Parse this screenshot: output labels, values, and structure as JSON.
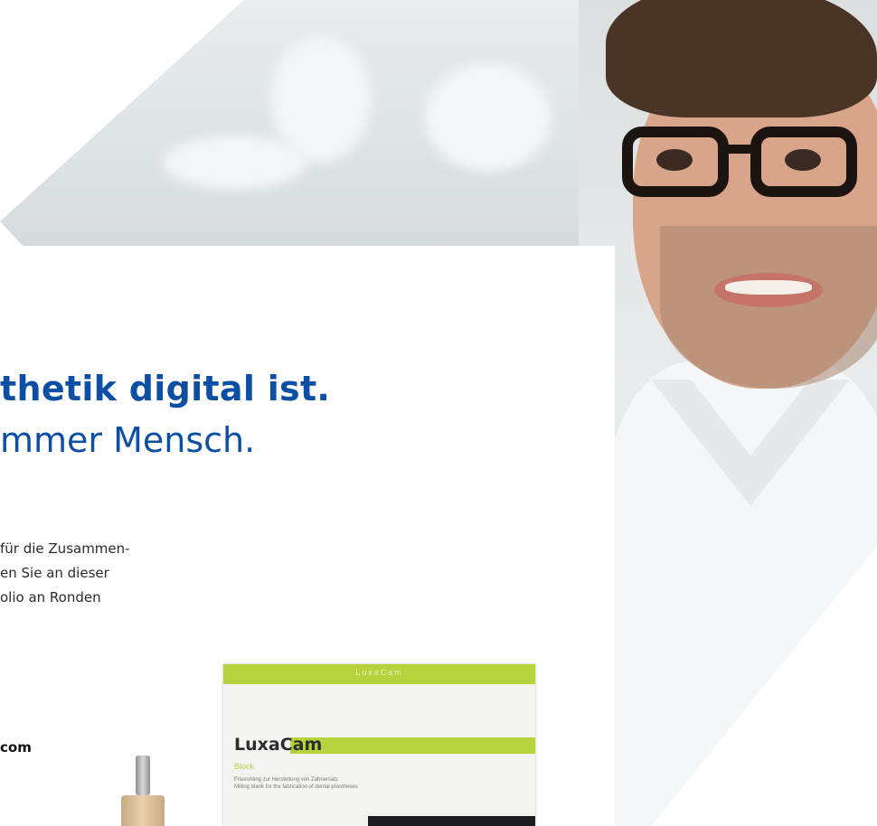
{
  "headline": {
    "line1": "thetik digital ist.",
    "line2": "mmer Mensch."
  },
  "body_lines": [
    "für die Zusammen-",
    "en Sie an dieser",
    "olio an Ronden"
  ],
  "website": "com",
  "product_box": {
    "top_strip": "LuxaCam",
    "brand": "LuxaCam",
    "variant": "Block",
    "description": [
      "Fräsrohling zur Herstellung von Zahnersatz",
      "Milling blank for the fabrication of dental prostheses"
    ]
  },
  "colors": {
    "headline_blue": "#0d4fa5",
    "lime_green": "#b6d23d",
    "body_text": "#2b2b2b"
  }
}
